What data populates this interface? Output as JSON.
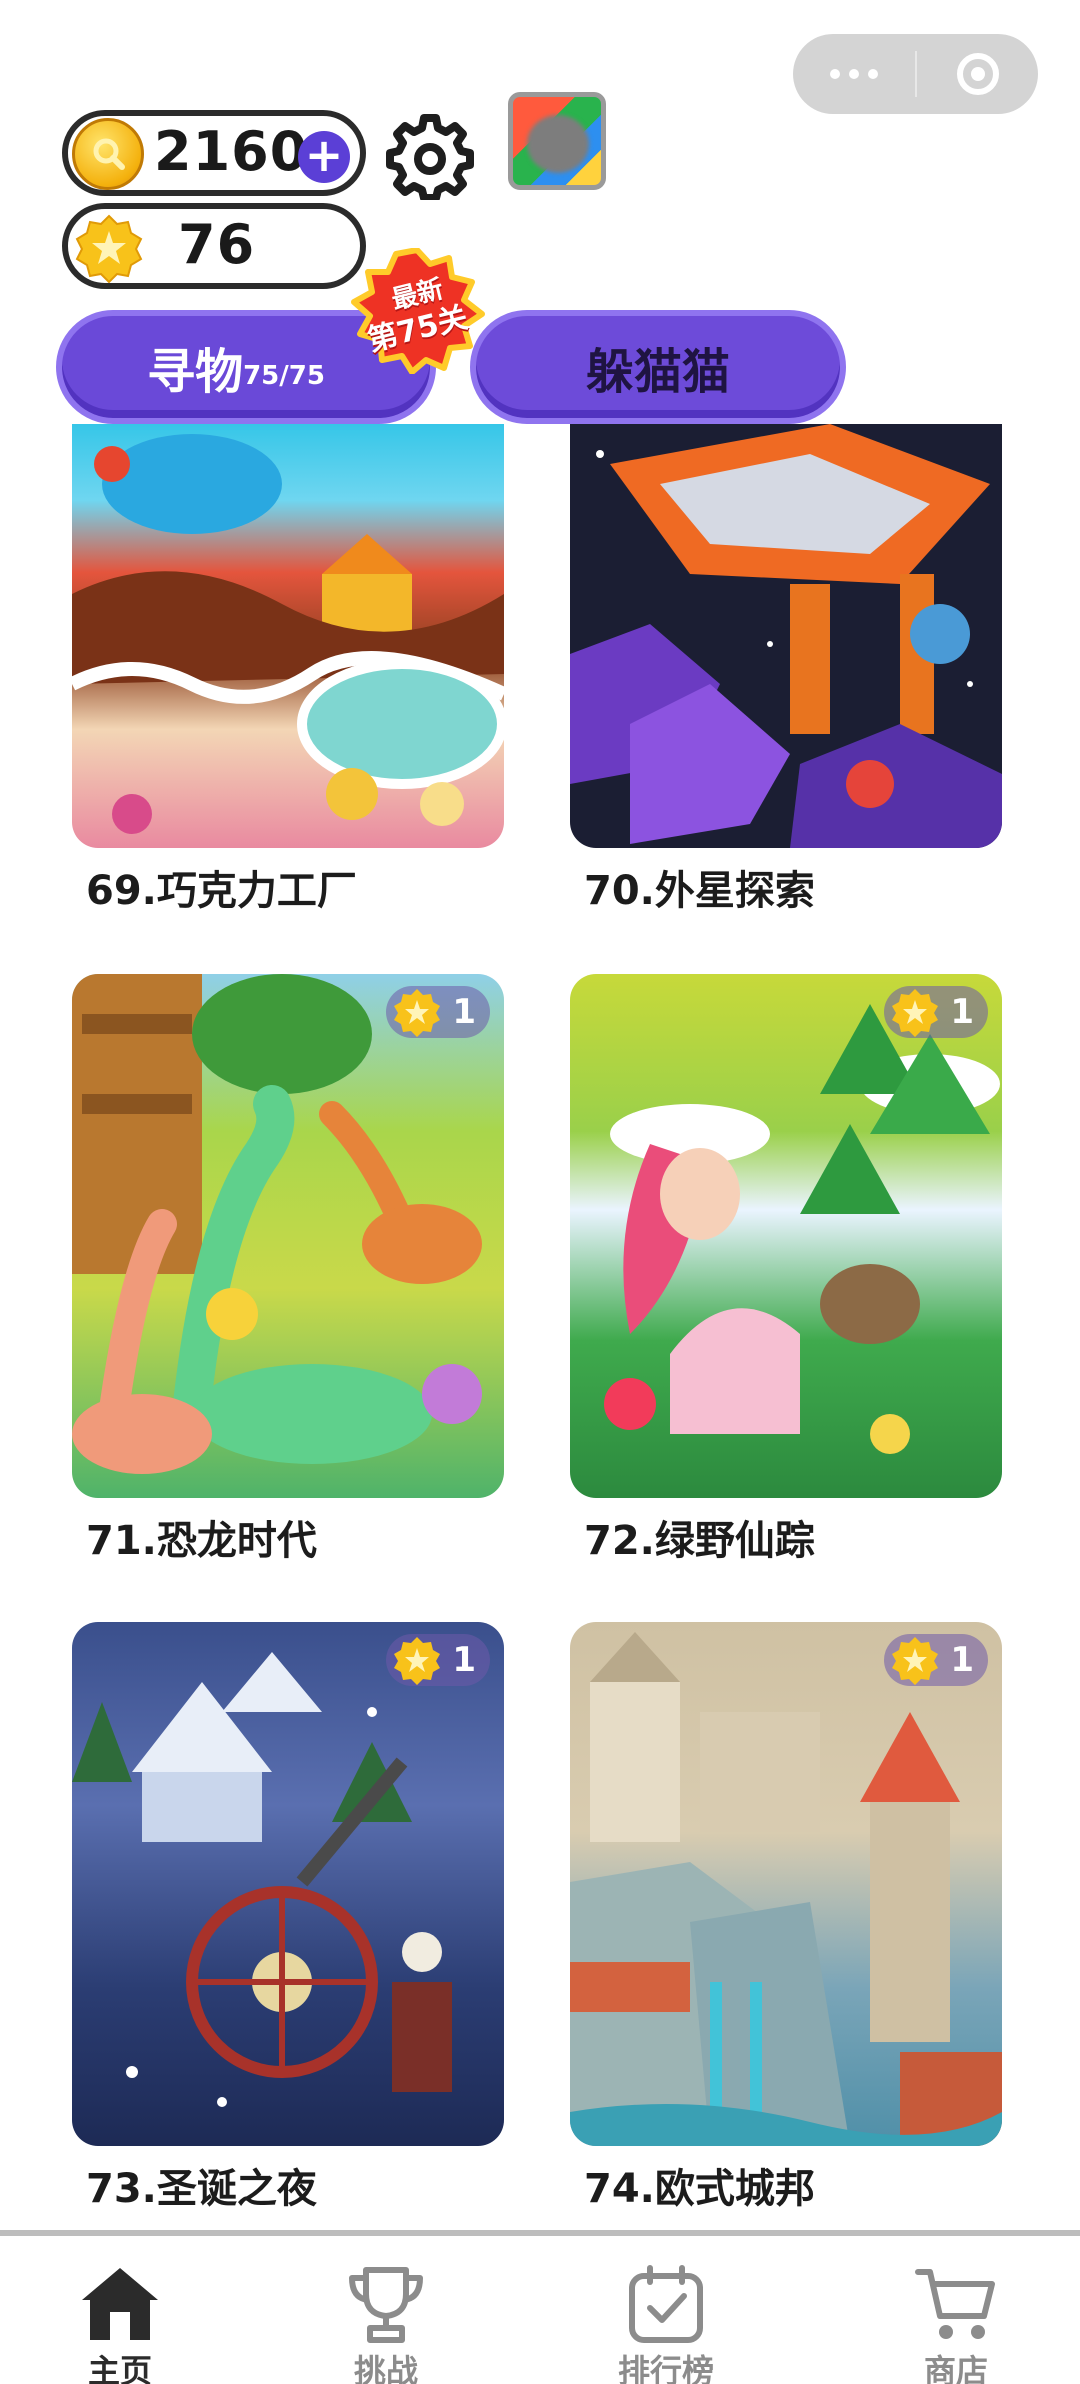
{
  "header": {
    "coins": "2160",
    "stars": "76"
  },
  "tabs": [
    {
      "label": "寻物",
      "progress": "75/75"
    },
    {
      "label": "躲猫猫"
    }
  ],
  "badge": {
    "line1": "最新",
    "line2": "第75关"
  },
  "levels": [
    {
      "name": "69.巧克力工厂"
    },
    {
      "name": "70.外星探索"
    },
    {
      "name": "71.恐龙时代",
      "stars": "1"
    },
    {
      "name": "72.绿野仙踪",
      "stars": "1"
    },
    {
      "name": "73.圣诞之夜",
      "stars": "1"
    },
    {
      "name": "74.欧式城邦",
      "stars": "1"
    }
  ],
  "nav": [
    {
      "label": "主页",
      "icon": "home-icon",
      "active": true
    },
    {
      "label": "挑战",
      "icon": "trophy-icon"
    },
    {
      "label": "排行榜",
      "icon": "calendar-check-icon"
    },
    {
      "label": "商店",
      "icon": "cart-icon"
    }
  ],
  "colors": {
    "accent": "#6a49d8",
    "plus": "#5b3fd6",
    "star": "#f4b10d"
  }
}
